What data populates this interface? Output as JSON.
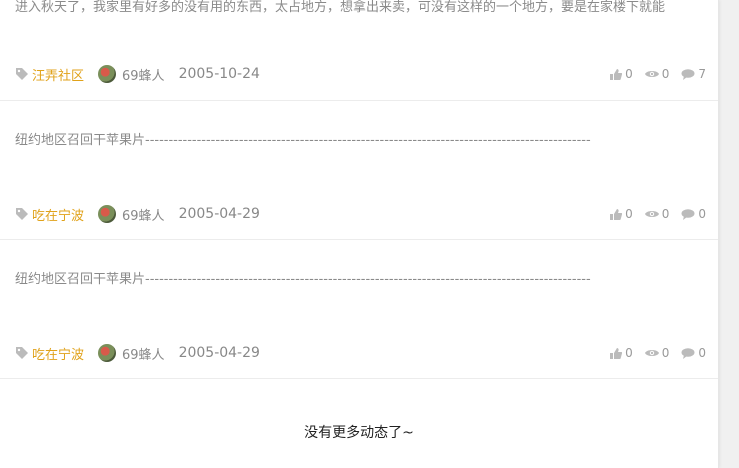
{
  "posts": [
    {
      "text": "进入秋天了，我家里有好多的没有用的东西，太占地方，想拿出来卖，可没有这样的一个地方，要是在家楼下就能",
      "category": "汪弄社区",
      "author": "69蜂人",
      "date": "2005-10-24",
      "likes": "0",
      "views": "0",
      "comments": "7"
    },
    {
      "text": "纽约地区召回干苹果片-----------------------------------------------------------------------------------------------",
      "category": "吃在宁波",
      "author": "69蜂人",
      "date": "2005-04-29",
      "likes": "0",
      "views": "0",
      "comments": "0"
    },
    {
      "text": "纽约地区召回干苹果片-----------------------------------------------------------------------------------------------",
      "category": "吃在宁波",
      "author": "69蜂人",
      "date": "2005-04-29",
      "likes": "0",
      "views": "0",
      "comments": "0"
    }
  ],
  "footer": {
    "no_more_text": "没有更多动态了~"
  },
  "colors": {
    "category": "#e0a21a",
    "text": "#8a8a8a",
    "meta": "#999999"
  }
}
